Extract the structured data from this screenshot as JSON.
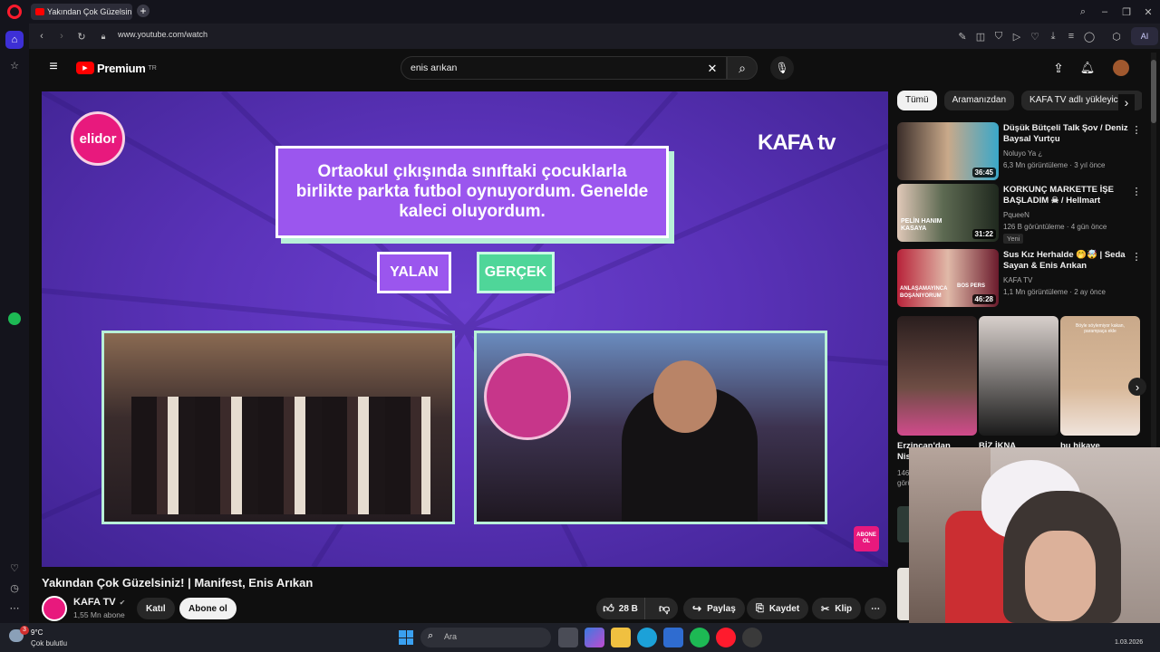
{
  "browser": {
    "tab_title": "Yakından Çok Güzelsin",
    "url": "www.youtube.com/watch",
    "ai_label": "AI"
  },
  "youtube": {
    "brand": "Premium",
    "brand_sup": "TR",
    "search_value": "enis arıkan",
    "chips": [
      "Tümü",
      "Aramanızdan",
      "KAFA TV adlı yükleyiciden"
    ],
    "video": {
      "title": "Yakından Çok Güzelsiniz! | Manifest, Enis Arıkan",
      "channel": "KAFA TV",
      "subscribers": "1,55 Mn abone",
      "join_label": "Katıl",
      "subscribe_label": "Abone ol",
      "likes": "28 B",
      "share_label": "Paylaş",
      "save_label": "Kaydet",
      "clip_label": "Klip"
    },
    "player": {
      "sponsor": "elidor",
      "brand_logo": "KAFA tv",
      "question": "Ortaokul çıkışında sınıftaki çocuklarla birlikte parkta futbol oynuyordum. Genelde kaleci oluyordum.",
      "option_false": "YALAN",
      "option_true": "GERÇEK",
      "corner_badge": "ABONE OL"
    },
    "recommendations": [
      {
        "title": "Düşük Bütçeli Talk Şov / Deniz Baysal Yurtçu",
        "channel": "Noluyo Ya ¿",
        "meta": "6,3 Mn görüntüleme · 3 yıl önce",
        "duration": "36:45",
        "thumb_color": "#c9a98a",
        "badge": ""
      },
      {
        "title": "KORKUNÇ MARKETTE İŞE BAŞLADIM ☠ / Hellmart",
        "channel": "PqueeN",
        "meta": "126 B görüntüleme · 4 gün önce",
        "duration": "31:22",
        "thumb_color": "#3e4a3a",
        "badge": "Yeni"
      },
      {
        "title": "Sus Kız Herhalde 🤭🤯 | Seda Sayan & Enis Arıkan",
        "channel": "KAFA TV",
        "meta": "1,1 Mn görüntüleme · 2 ay önce",
        "duration": "46:28",
        "thumb_color": "#b8233a",
        "badge": ""
      }
    ],
    "thumb_overlays": {
      "r1": "PELİN HANIM KASAYA",
      "r2_left": "ANLAŞAMAYINCA BOŞANIYORUM",
      "r2_right": "BOS PERS"
    },
    "shorts": [
      {
        "title": "Erzincan'dan Nis...",
        "color": "#6e4d44"
      },
      {
        "title": "BİZ İKNA",
        "color": "#d8d0cc"
      },
      {
        "title": "bu hikaye",
        "color": "#d9b99a"
      }
    ],
    "short_overlay": "Böyle söylemiyor kakan, parampaça ekle",
    "partial_meta": "146 görü"
  },
  "taskbar": {
    "weather_temp": "9°C",
    "weather_desc": "Çok bulutlu",
    "weather_badge": "3",
    "search_placeholder": "Ara",
    "date": "1.03.2026"
  }
}
